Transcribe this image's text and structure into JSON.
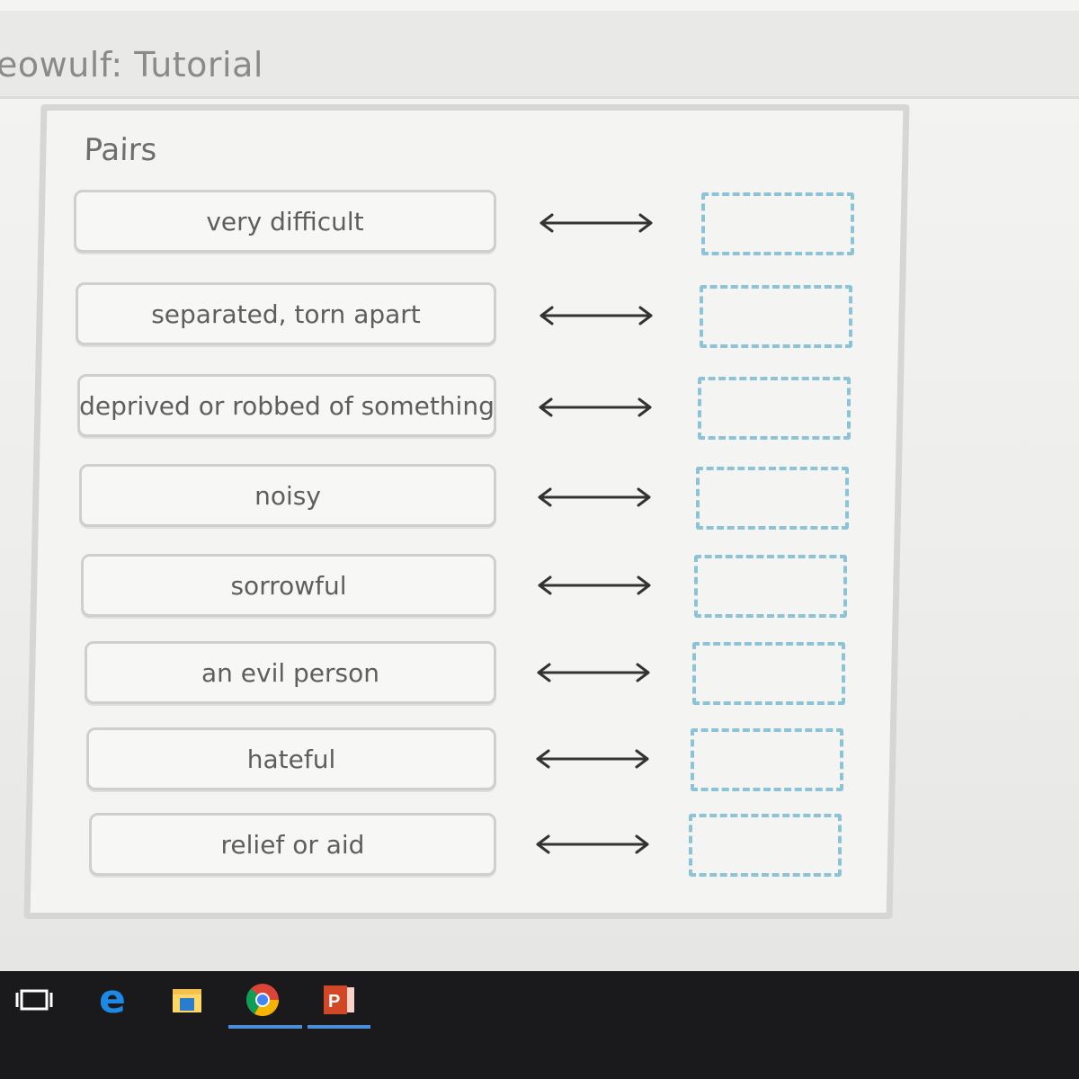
{
  "window": {
    "title": "eowulf: Tutorial"
  },
  "panel": {
    "heading": "Pairs",
    "pairs": [
      {
        "term": "very difficult"
      },
      {
        "term": "separated, torn apart"
      },
      {
        "term": "deprived or robbed of something"
      },
      {
        "term": "noisy"
      },
      {
        "term": "sorrowful"
      },
      {
        "term": "an evil person"
      },
      {
        "term": "hateful"
      },
      {
        "term": "relief or aid"
      }
    ],
    "arrow_icon": "double-headed-arrow-icon",
    "drop_target_color": "#8cc3d6"
  },
  "taskbar": {
    "items": [
      {
        "icon": "task-view-icon"
      },
      {
        "icon": "edge-browser-icon"
      },
      {
        "icon": "file-explorer-icon"
      },
      {
        "icon": "chrome-icon",
        "active": true
      },
      {
        "icon": "powerpoint-icon",
        "active": true
      }
    ]
  }
}
